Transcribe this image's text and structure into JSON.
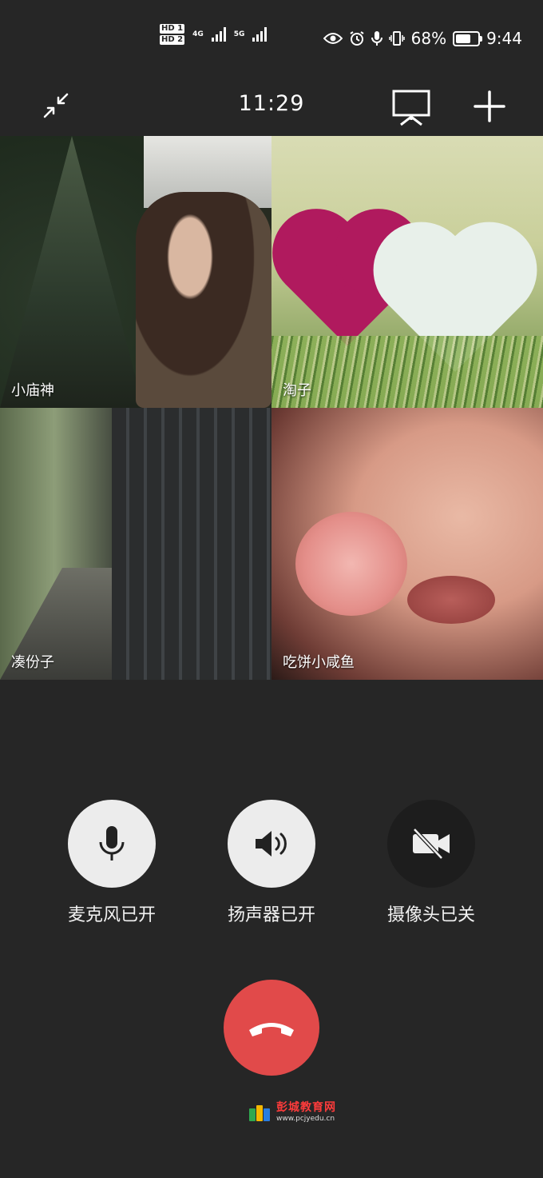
{
  "status_bar": {
    "hd1": "HD 1",
    "hd2": "HD 2",
    "network": "4G",
    "network2": "5G",
    "battery_percent": "68%",
    "battery_level": 0.68,
    "clock": "9:44"
  },
  "call": {
    "timer": "11:29"
  },
  "participants": [
    {
      "name": "小庙神"
    },
    {
      "name": "淘子"
    },
    {
      "name": "凑份子"
    },
    {
      "name": "吃饼小咸鱼"
    }
  ],
  "controls": {
    "mic_label": "麦克风已开",
    "speaker_label": "扬声器已开",
    "camera_label": "摄像头已关"
  },
  "watermark": {
    "name": "彭城教育网",
    "url": "www.pcjyedu.cn"
  },
  "colors": {
    "background": "#262626",
    "hangup": "#e14a4a",
    "control_on": "#ececec",
    "control_off": "#1d1d1d"
  }
}
